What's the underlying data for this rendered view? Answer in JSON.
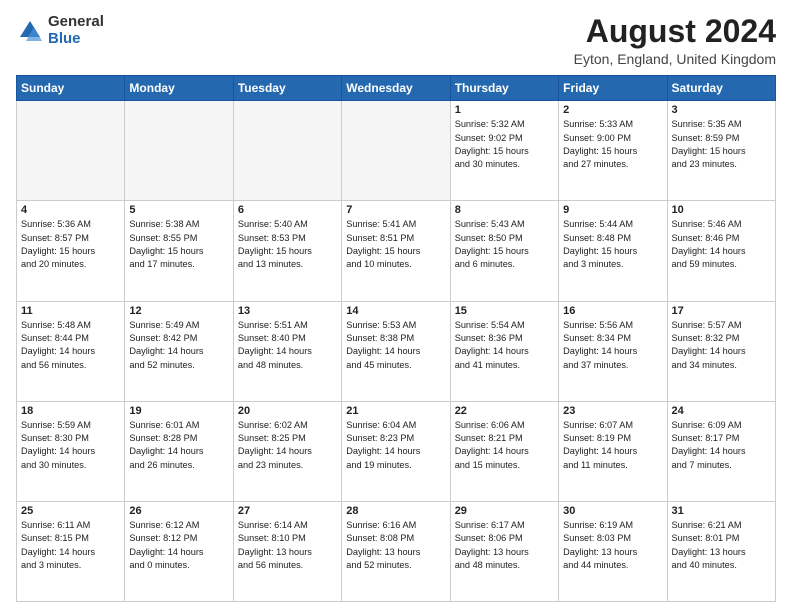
{
  "header": {
    "logo_general": "General",
    "logo_blue": "Blue",
    "month_title": "August 2024",
    "location": "Eyton, England, United Kingdom"
  },
  "days_of_week": [
    "Sunday",
    "Monday",
    "Tuesday",
    "Wednesday",
    "Thursday",
    "Friday",
    "Saturday"
  ],
  "weeks": [
    [
      {
        "day": "",
        "info": ""
      },
      {
        "day": "",
        "info": ""
      },
      {
        "day": "",
        "info": ""
      },
      {
        "day": "",
        "info": ""
      },
      {
        "day": "1",
        "info": "Sunrise: 5:32 AM\nSunset: 9:02 PM\nDaylight: 15 hours\nand 30 minutes."
      },
      {
        "day": "2",
        "info": "Sunrise: 5:33 AM\nSunset: 9:00 PM\nDaylight: 15 hours\nand 27 minutes."
      },
      {
        "day": "3",
        "info": "Sunrise: 5:35 AM\nSunset: 8:59 PM\nDaylight: 15 hours\nand 23 minutes."
      }
    ],
    [
      {
        "day": "4",
        "info": "Sunrise: 5:36 AM\nSunset: 8:57 PM\nDaylight: 15 hours\nand 20 minutes."
      },
      {
        "day": "5",
        "info": "Sunrise: 5:38 AM\nSunset: 8:55 PM\nDaylight: 15 hours\nand 17 minutes."
      },
      {
        "day": "6",
        "info": "Sunrise: 5:40 AM\nSunset: 8:53 PM\nDaylight: 15 hours\nand 13 minutes."
      },
      {
        "day": "7",
        "info": "Sunrise: 5:41 AM\nSunset: 8:51 PM\nDaylight: 15 hours\nand 10 minutes."
      },
      {
        "day": "8",
        "info": "Sunrise: 5:43 AM\nSunset: 8:50 PM\nDaylight: 15 hours\nand 6 minutes."
      },
      {
        "day": "9",
        "info": "Sunrise: 5:44 AM\nSunset: 8:48 PM\nDaylight: 15 hours\nand 3 minutes."
      },
      {
        "day": "10",
        "info": "Sunrise: 5:46 AM\nSunset: 8:46 PM\nDaylight: 14 hours\nand 59 minutes."
      }
    ],
    [
      {
        "day": "11",
        "info": "Sunrise: 5:48 AM\nSunset: 8:44 PM\nDaylight: 14 hours\nand 56 minutes."
      },
      {
        "day": "12",
        "info": "Sunrise: 5:49 AM\nSunset: 8:42 PM\nDaylight: 14 hours\nand 52 minutes."
      },
      {
        "day": "13",
        "info": "Sunrise: 5:51 AM\nSunset: 8:40 PM\nDaylight: 14 hours\nand 48 minutes."
      },
      {
        "day": "14",
        "info": "Sunrise: 5:53 AM\nSunset: 8:38 PM\nDaylight: 14 hours\nand 45 minutes."
      },
      {
        "day": "15",
        "info": "Sunrise: 5:54 AM\nSunset: 8:36 PM\nDaylight: 14 hours\nand 41 minutes."
      },
      {
        "day": "16",
        "info": "Sunrise: 5:56 AM\nSunset: 8:34 PM\nDaylight: 14 hours\nand 37 minutes."
      },
      {
        "day": "17",
        "info": "Sunrise: 5:57 AM\nSunset: 8:32 PM\nDaylight: 14 hours\nand 34 minutes."
      }
    ],
    [
      {
        "day": "18",
        "info": "Sunrise: 5:59 AM\nSunset: 8:30 PM\nDaylight: 14 hours\nand 30 minutes."
      },
      {
        "day": "19",
        "info": "Sunrise: 6:01 AM\nSunset: 8:28 PM\nDaylight: 14 hours\nand 26 minutes."
      },
      {
        "day": "20",
        "info": "Sunrise: 6:02 AM\nSunset: 8:25 PM\nDaylight: 14 hours\nand 23 minutes."
      },
      {
        "day": "21",
        "info": "Sunrise: 6:04 AM\nSunset: 8:23 PM\nDaylight: 14 hours\nand 19 minutes."
      },
      {
        "day": "22",
        "info": "Sunrise: 6:06 AM\nSunset: 8:21 PM\nDaylight: 14 hours\nand 15 minutes."
      },
      {
        "day": "23",
        "info": "Sunrise: 6:07 AM\nSunset: 8:19 PM\nDaylight: 14 hours\nand 11 minutes."
      },
      {
        "day": "24",
        "info": "Sunrise: 6:09 AM\nSunset: 8:17 PM\nDaylight: 14 hours\nand 7 minutes."
      }
    ],
    [
      {
        "day": "25",
        "info": "Sunrise: 6:11 AM\nSunset: 8:15 PM\nDaylight: 14 hours\nand 3 minutes."
      },
      {
        "day": "26",
        "info": "Sunrise: 6:12 AM\nSunset: 8:12 PM\nDaylight: 14 hours\nand 0 minutes."
      },
      {
        "day": "27",
        "info": "Sunrise: 6:14 AM\nSunset: 8:10 PM\nDaylight: 13 hours\nand 56 minutes."
      },
      {
        "day": "28",
        "info": "Sunrise: 6:16 AM\nSunset: 8:08 PM\nDaylight: 13 hours\nand 52 minutes."
      },
      {
        "day": "29",
        "info": "Sunrise: 6:17 AM\nSunset: 8:06 PM\nDaylight: 13 hours\nand 48 minutes."
      },
      {
        "day": "30",
        "info": "Sunrise: 6:19 AM\nSunset: 8:03 PM\nDaylight: 13 hours\nand 44 minutes."
      },
      {
        "day": "31",
        "info": "Sunrise: 6:21 AM\nSunset: 8:01 PM\nDaylight: 13 hours\nand 40 minutes."
      }
    ]
  ]
}
